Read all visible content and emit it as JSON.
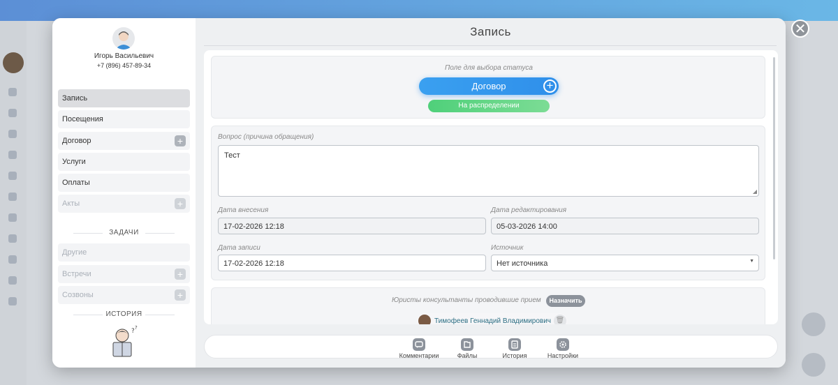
{
  "sidebar": {
    "client_name": "Игорь Васильевич",
    "client_phone": "+7 (896) 457-89-34",
    "menu": [
      {
        "label": "Запись",
        "active": true
      },
      {
        "label": "Посещения"
      },
      {
        "label": "Договор",
        "plus": true
      },
      {
        "label": "Услуги"
      },
      {
        "label": "Оплаты"
      },
      {
        "label": "Акты",
        "plus": true,
        "dim": true
      }
    ],
    "tasks_heading": "ЗАДАЧИ",
    "tasks": [
      {
        "label": "Другие"
      },
      {
        "label": "Встречи",
        "plus": true
      },
      {
        "label": "Созвоны",
        "plus": true
      }
    ],
    "history_heading": "ИСТОРИЯ"
  },
  "main": {
    "title": "Запись",
    "status": {
      "field_label": "Поле для выбора статуса",
      "status_button": "Договор",
      "substatus": "На распределении"
    },
    "form": {
      "question_label": "Вопрос (причина обращения)",
      "question_value": "Тест",
      "date_created_label": "Дата внесения",
      "date_created_value": "17-02-2026 12:18",
      "date_edited_label": "Дата редактирования",
      "date_edited_value": "05-03-2026 14:00",
      "date_record_label": "Дата записи",
      "date_record_value": "17-02-2026 12:18",
      "source_label": "Источник",
      "source_value": "Нет источника"
    },
    "lawyers": {
      "label": "Юристы консультанты проводившие прием",
      "assign_button": "Назначить",
      "items": [
        {
          "name": "Тимофеев Геннадий Владимирович"
        }
      ]
    },
    "bottom_bar": [
      {
        "label": "Комментарии",
        "icon": "comment-icon"
      },
      {
        "label": "Файлы",
        "icon": "files-icon"
      },
      {
        "label": "История",
        "icon": "history-icon"
      },
      {
        "label": "Настройки",
        "icon": "settings-icon"
      }
    ]
  },
  "colors": {
    "status_button": "#2f8fea",
    "substatus": "#4fd07a",
    "lawyer_name": "#2c6e83"
  }
}
